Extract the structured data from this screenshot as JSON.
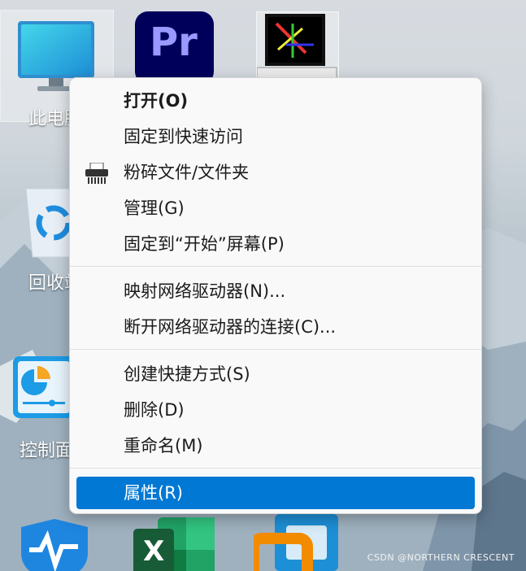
{
  "desktop": {
    "icons": [
      {
        "label": "此电脑",
        "icon": "monitor-icon"
      },
      {
        "label": "回收站",
        "icon": "recycle-bin-icon"
      },
      {
        "label": "控制面板",
        "icon": "control-panel-icon"
      },
      {
        "label": "Pr",
        "icon": "premiere-pro-icon"
      },
      {
        "label": "",
        "icon": "retro-computer-icon"
      },
      {
        "label": "",
        "icon": "wise-care-icon"
      },
      {
        "label": "X",
        "icon": "excel-icon"
      },
      {
        "label": "",
        "icon": "vmware-icon"
      }
    ],
    "watermark": "CSDN @NORTHERN  CRESCENT"
  },
  "context_menu": {
    "items": [
      {
        "label": "打开(O)",
        "bold": true
      },
      {
        "label": "固定到快速访问"
      },
      {
        "label": "粉碎文件/文件夹",
        "icon": "shredder-icon"
      },
      {
        "label": "管理(G)"
      },
      {
        "label": "固定到“开始”屏幕(P)"
      },
      {
        "label": "映射网络驱动器(N)..."
      },
      {
        "label": "断开网络驱动器的连接(C)..."
      },
      {
        "label": "创建快捷方式(S)"
      },
      {
        "label": "删除(D)"
      },
      {
        "label": "重命名(M)"
      },
      {
        "label": "属性(R)",
        "highlighted": true
      }
    ]
  },
  "colors": {
    "highlight": "#0078d4",
    "menu_bg": "#f9f9f9"
  }
}
